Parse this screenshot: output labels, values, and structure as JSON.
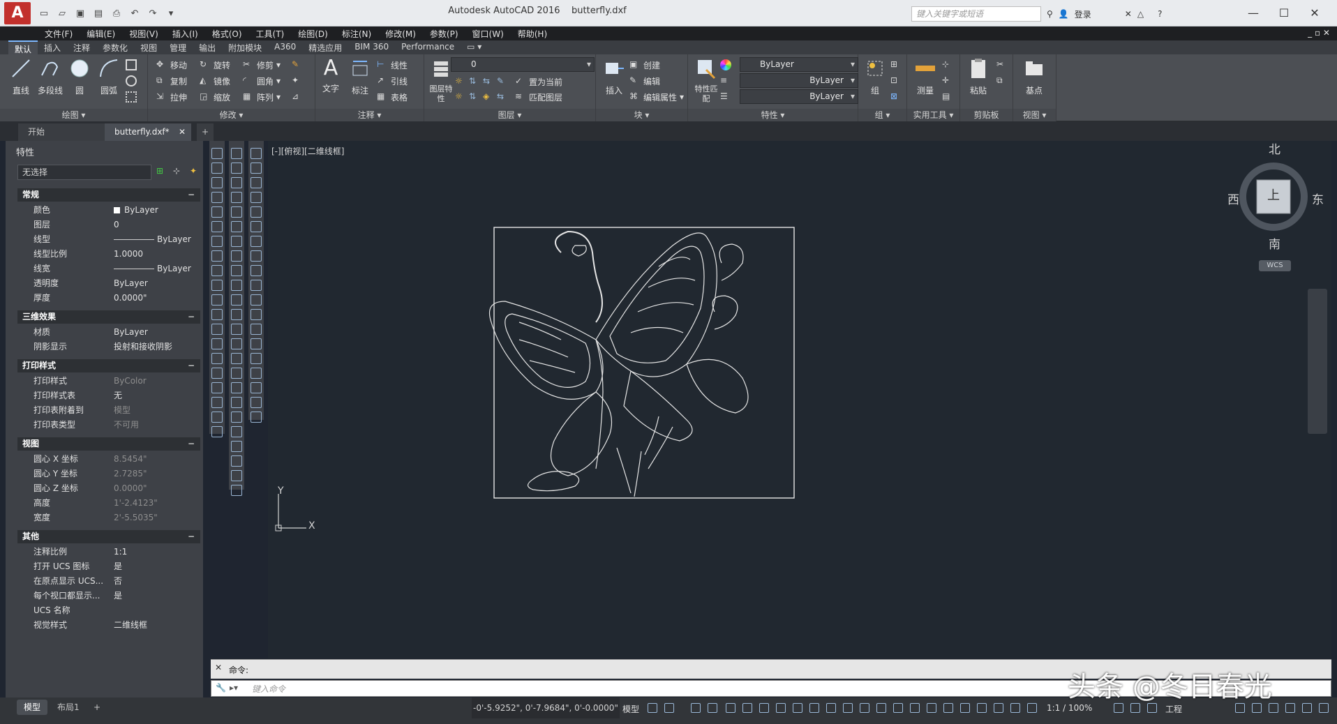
{
  "title_bar": {
    "app_name": "Autodesk AutoCAD 2016",
    "file_name": "butterfly.dxf",
    "search_placeholder": "键入关键字或短语",
    "login_label": "登录"
  },
  "menu": [
    "文件(F)",
    "编辑(E)",
    "视图(V)",
    "插入(I)",
    "格式(O)",
    "工具(T)",
    "绘图(D)",
    "标注(N)",
    "修改(M)",
    "参数(P)",
    "窗口(W)",
    "帮助(H)"
  ],
  "ribbon_tabs": [
    "默认",
    "插入",
    "注释",
    "参数化",
    "视图",
    "管理",
    "输出",
    "附加模块",
    "A360",
    "精选应用",
    "BIM 360",
    "Performance"
  ],
  "ribbon": {
    "draw": {
      "title": "绘图",
      "line": "直线",
      "polyline": "多段线",
      "circle": "圆",
      "arc": "圆弧"
    },
    "modify": {
      "title": "修改",
      "move": "移动",
      "rotate": "旋转",
      "trim": "修剪",
      "copy": "复制",
      "mirror": "镜像",
      "fillet": "圆角",
      "stretch": "拉伸",
      "scale": "缩放",
      "array": "阵列"
    },
    "annotation": {
      "title": "注释",
      "text": "文字",
      "dimension": "标注",
      "linear": "线性",
      "leader": "引线",
      "table": "表格"
    },
    "layers": {
      "title": "图层",
      "layer_props": "图层特性",
      "layer_value": "0",
      "set_current": "置为当前",
      "match_layer": "匹配图层"
    },
    "block": {
      "title": "块",
      "insert": "插入",
      "create": "创建",
      "edit": "编辑",
      "edit_attr": "编辑属性"
    },
    "properties": {
      "title": "特性",
      "match": "特性匹配",
      "color": "ByLayer",
      "linetype": "ByLayer",
      "lineweight": "ByLayer"
    },
    "groups": {
      "title": "组",
      "group": "组"
    },
    "utilities": {
      "title": "实用工具",
      "measure": "测量"
    },
    "clipboard": {
      "title": "剪贴板",
      "paste": "粘贴"
    },
    "view": {
      "title": "视图",
      "base": "基点"
    }
  },
  "file_tabs": {
    "start": "开始",
    "current": "butterfly.dxf*"
  },
  "properties_palette": {
    "title": "特性",
    "selection": "无选择",
    "sections": {
      "general": {
        "title": "常规",
        "rows": [
          {
            "k": "颜色",
            "v": "ByLayer"
          },
          {
            "k": "图层",
            "v": "0"
          },
          {
            "k": "线型",
            "v": "ByLayer"
          },
          {
            "k": "线型比例",
            "v": "1.0000"
          },
          {
            "k": "线宽",
            "v": "ByLayer"
          },
          {
            "k": "透明度",
            "v": "ByLayer"
          },
          {
            "k": "厚度",
            "v": "0.0000\""
          }
        ]
      },
      "effects3d": {
        "title": "三维效果",
        "rows": [
          {
            "k": "材质",
            "v": "ByLayer"
          },
          {
            "k": "阴影显示",
            "v": "投射和接收阴影"
          }
        ]
      },
      "plot": {
        "title": "打印样式",
        "rows": [
          {
            "k": "打印样式",
            "v": "ByColor"
          },
          {
            "k": "打印样式表",
            "v": "无"
          },
          {
            "k": "打印表附着到",
            "v": "模型"
          },
          {
            "k": "打印表类型",
            "v": "不可用"
          }
        ]
      },
      "view": {
        "title": "视图",
        "rows": [
          {
            "k": "圆心 X 坐标",
            "v": "8.5454\""
          },
          {
            "k": "圆心 Y 坐标",
            "v": "2.7285\""
          },
          {
            "k": "圆心 Z 坐标",
            "v": "0.0000\""
          },
          {
            "k": "高度",
            "v": "1'-2.4123\""
          },
          {
            "k": "宽度",
            "v": "2'-5.5035\""
          }
        ]
      },
      "misc": {
        "title": "其他",
        "rows": [
          {
            "k": "注释比例",
            "v": "1:1"
          },
          {
            "k": "打开 UCS 图标",
            "v": "是"
          },
          {
            "k": "在原点显示 UCS...",
            "v": "否"
          },
          {
            "k": "每个视口都显示...",
            "v": "是"
          },
          {
            "k": "UCS 名称",
            "v": ""
          },
          {
            "k": "视觉样式",
            "v": "二维线框"
          }
        ]
      }
    }
  },
  "viewport": {
    "label": "[-][俯视][二维线框]",
    "viewcube": {
      "north": "北",
      "south": "南",
      "east": "东",
      "west": "西",
      "face": "上",
      "wcs": "WCS"
    },
    "ucs": {
      "x": "X",
      "y": "Y"
    }
  },
  "command": {
    "history_label": "命令:",
    "input_placeholder": "键入命令"
  },
  "status": {
    "layout_tabs": [
      "模型",
      "布局1"
    ],
    "coords": "-0'-5.9252\", 0'-7.9684\", 0'-0.0000\"",
    "model_label": "模型",
    "scale": "1:1 / 100%",
    "workspace": "工程"
  },
  "watermark": "头条 @冬日春光",
  "colors": {
    "background": "#212830",
    "ribbon": "#4c4f54",
    "palette": "#3e4147",
    "accent": "#7eb8ff"
  }
}
